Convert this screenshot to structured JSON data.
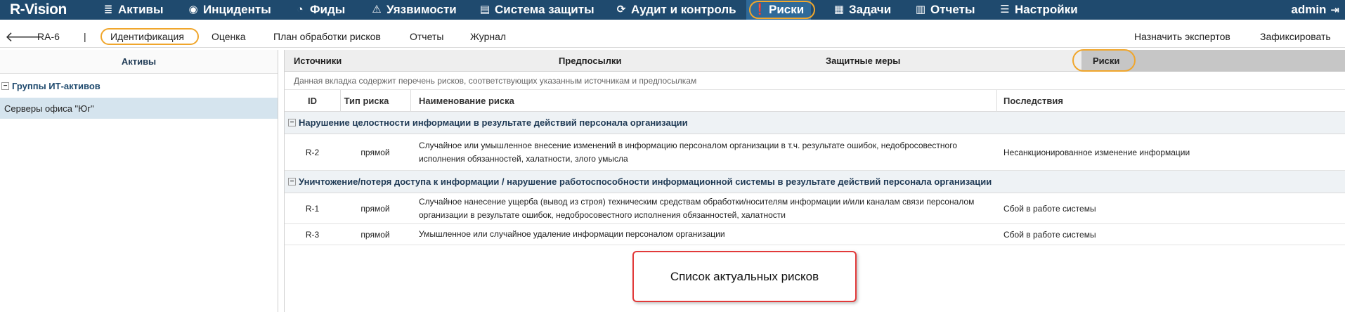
{
  "topbar": {
    "logo": "R-Vision",
    "nav": [
      {
        "label": "Активы",
        "icon": "database-icon"
      },
      {
        "label": "Инциденты",
        "icon": "target-icon"
      },
      {
        "label": "Фиды",
        "icon": "rss-icon"
      },
      {
        "label": "Уязвимости",
        "icon": "warning-icon"
      },
      {
        "label": "Система защиты",
        "icon": "layers-icon"
      },
      {
        "label": "Аудит и контроль",
        "icon": "refresh-icon"
      },
      {
        "label": "Риски",
        "icon": "alert-icon",
        "active": true
      },
      {
        "label": "Задачи",
        "icon": "calendar-icon"
      },
      {
        "label": "Отчеты",
        "icon": "report-icon"
      },
      {
        "label": "Настройки",
        "icon": "menu-icon"
      }
    ],
    "user": "admin"
  },
  "subbar": {
    "id": "RA-6",
    "separator": "|",
    "tabs": [
      "Идентификация",
      "Оценка",
      "План обработки рисков",
      "Отчеты",
      "Журнал"
    ],
    "active_tab": "Идентификация",
    "assign_experts": "Назначить экспертов",
    "fix": "Зафиксировать"
  },
  "left": {
    "title": "Активы",
    "group": "Группы ИТ-активов",
    "item": "Серверы офиса \"Юг\""
  },
  "tabs": [
    "Источники",
    "Предпосылки",
    "Защитные меры",
    "Риски"
  ],
  "active_tab": "Риски",
  "description": "Данная вкладка содержит перечень рисков, соответствующих указанным источникам и предпосылкам",
  "columns": [
    "ID",
    "Тип риска",
    "Наименование риска",
    "Последствия"
  ],
  "groups": [
    {
      "title": "Нарушение целостности информации в результате действий персонала организации",
      "rows": [
        {
          "id": "R-2",
          "type": "прямой",
          "name": "Случайное или умышленное внесение изменений в информацию персоналом организации в т.ч. результате ошибок, недобросовестного исполнения обязанностей, халатности, злого умысла",
          "consequence": "Несанкционированное изменение информации"
        }
      ]
    },
    {
      "title": "Уничтожение/потеря доступа к информации / нарушение работоспособности информационной системы в результате действий персонала организации",
      "rows": [
        {
          "id": "R-1",
          "type": "прямой",
          "name": "Случайное нанесение ущерба (вывод из строя) техническим средствам обработки/носителям информации и/или каналам связи персоналом организации в результате ошибок, недобросовестного исполнения обязанностей, халатности",
          "consequence": "Сбой в работе системы"
        },
        {
          "id": "R-3",
          "type": "прямой",
          "name": "Умышленное или случайное удаление информации персоналом организации",
          "consequence": "Сбой в работе системы"
        }
      ]
    }
  ],
  "callout": "Список актуальных рисков",
  "colors": {
    "topbar": "#1f4a6e",
    "highlight": "#f0a62c",
    "callout_border": "#e23a3a"
  }
}
